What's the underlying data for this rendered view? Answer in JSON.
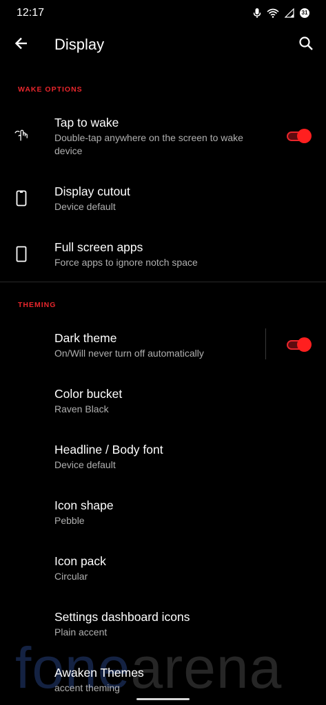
{
  "status_bar": {
    "time": "12:17",
    "icons": [
      "mic-icon",
      "wifi-icon",
      "signal-icon",
      "calendar-badge-icon"
    ],
    "badge_text": "31"
  },
  "app_bar": {
    "title": "Display",
    "back_icon": "arrow-left-icon",
    "search_icon": "search-icon"
  },
  "sections": {
    "wake": {
      "header": "WAKE OPTIONS"
    },
    "theming": {
      "header": "THEMING"
    }
  },
  "items": {
    "tap_to_wake": {
      "title": "Tap to wake",
      "summary": "Double-tap anywhere on the screen to wake device",
      "toggle_on": true,
      "icon": "tap-gesture-icon"
    },
    "display_cutout": {
      "title": "Display cutout",
      "summary": "Device default",
      "icon": "phone-cutout-icon"
    },
    "full_screen_apps": {
      "title": "Full screen apps",
      "summary": "Force apps to ignore notch space",
      "icon": "phone-fullscreen-icon"
    },
    "dark_theme": {
      "title": "Dark theme",
      "summary": "On/Will never turn off automatically",
      "toggle_on": true
    },
    "color_bucket": {
      "title": "Color bucket",
      "summary": "Raven Black"
    },
    "headline_font": {
      "title": "Headline / Body font",
      "summary": "Device default"
    },
    "icon_shape": {
      "title": "Icon shape",
      "summary": "Pebble"
    },
    "icon_pack": {
      "title": "Icon pack",
      "summary": "Circular"
    },
    "dashboard_icons": {
      "title": "Settings dashboard icons",
      "summary": "Plain accent"
    },
    "awaken_themes": {
      "title": "Awaken Themes",
      "summary": "accent theming"
    }
  },
  "watermark": {
    "part1": "fone",
    "part2": "arena"
  },
  "colors": {
    "background": "#000000",
    "accent": "#e8262c",
    "primary_text": "#ffffff",
    "secondary_text": "#b0b0b0"
  }
}
